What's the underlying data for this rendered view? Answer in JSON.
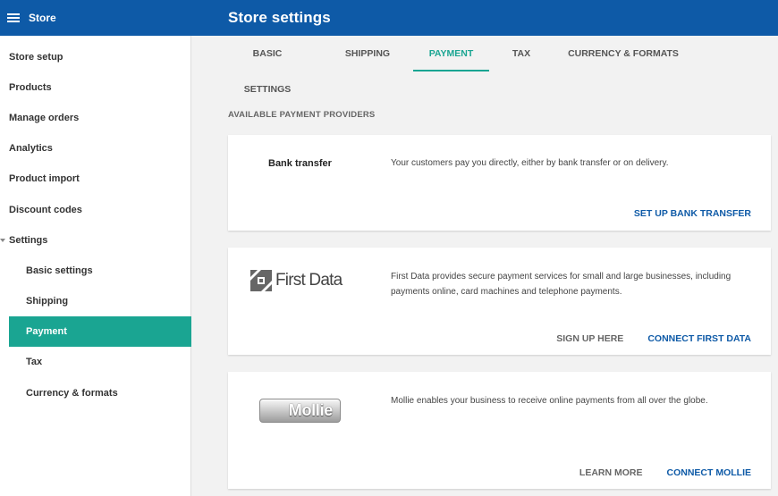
{
  "topbar": {
    "app_title": "Store",
    "page_title": "Store settings",
    "color": "#0e5aa7"
  },
  "sidebar": {
    "items": [
      {
        "label": "Store setup"
      },
      {
        "label": "Products"
      },
      {
        "label": "Manage orders"
      },
      {
        "label": "Analytics"
      },
      {
        "label": "Product import"
      },
      {
        "label": "Discount codes"
      },
      {
        "label": "Settings"
      }
    ],
    "settings_children": [
      {
        "label": "Basic settings"
      },
      {
        "label": "Shipping"
      },
      {
        "label": "Payment",
        "active": true
      },
      {
        "label": "Tax"
      },
      {
        "label": "Currency & formats"
      }
    ],
    "active_color": "#1aa592"
  },
  "tabs": [
    {
      "label": "Basic settings"
    },
    {
      "label": "Shipping"
    },
    {
      "label": "Payment",
      "active": true
    },
    {
      "label": "Tax"
    },
    {
      "label": "Currency & formats"
    }
  ],
  "section_label": "AVAILABLE PAYMENT PROVIDERS",
  "providers": [
    {
      "name": "Bank transfer",
      "description": "Your customers pay you directly, either by bank transfer or on delivery.",
      "primary_action": "SET UP BANK TRANSFER"
    },
    {
      "name": "First Data",
      "logo_text": "First Data",
      "description_line1": "First Data provides secure payment services for small and large businesses, including",
      "description_line2": "payments online, card machines and telephone payments.",
      "secondary_action": "SIGN UP HERE",
      "primary_action": "CONNECT FIRST DATA"
    },
    {
      "name": "Mollie",
      "logo_text": "Mollie",
      "description": "Mollie enables your business to receive online payments from all over the globe.",
      "secondary_action": "LEARN MORE",
      "primary_action": "CONNECT MOLLIE"
    }
  ]
}
